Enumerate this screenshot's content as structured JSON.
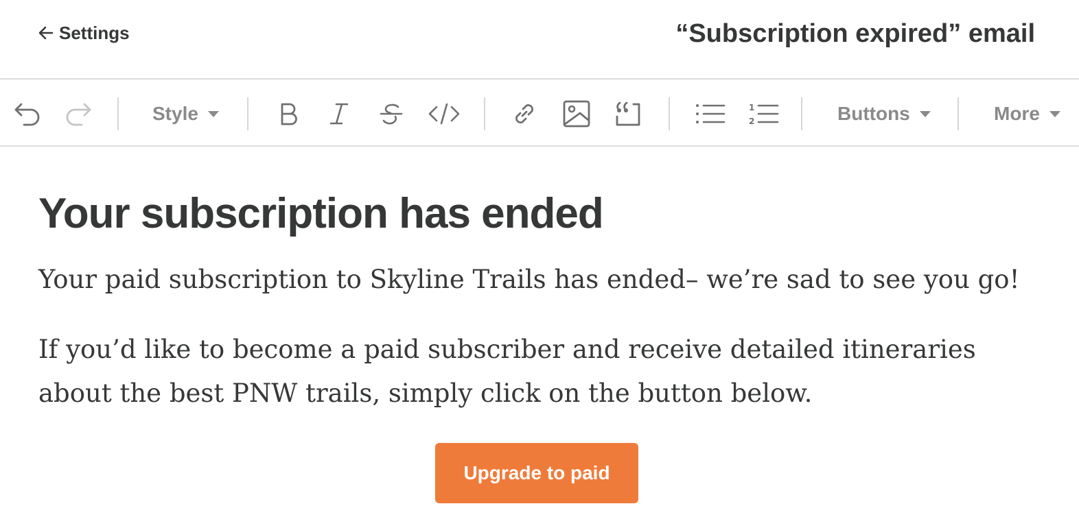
{
  "header": {
    "back_label": "Settings",
    "title": "“Subscription expired” email"
  },
  "toolbar": {
    "style_label": "Style",
    "buttons_label": "Buttons",
    "more_label": "More",
    "icons": [
      "undo-icon",
      "redo-icon",
      "bold-icon",
      "italic-icon",
      "strikethrough-icon",
      "code-icon",
      "link-icon",
      "image-icon",
      "quote-icon",
      "bullet-list-icon",
      "numbered-list-icon"
    ]
  },
  "email": {
    "heading": "Your subscription has ended",
    "paragraph1": "Your paid subscription to Skyline Trails has ended– we’re sad to see you go!",
    "paragraph2": "If you’d like to become a paid subscriber and receive detailed itineraries about the best PNW trails, simply click on the button below.",
    "cta_label": "Upgrade to paid"
  },
  "colors": {
    "cta_background": "#ef7b3a",
    "text": "#363737",
    "toolbar_icon": "#6f6f6f",
    "toolbar_icon_disabled": "#c4c4c4"
  }
}
